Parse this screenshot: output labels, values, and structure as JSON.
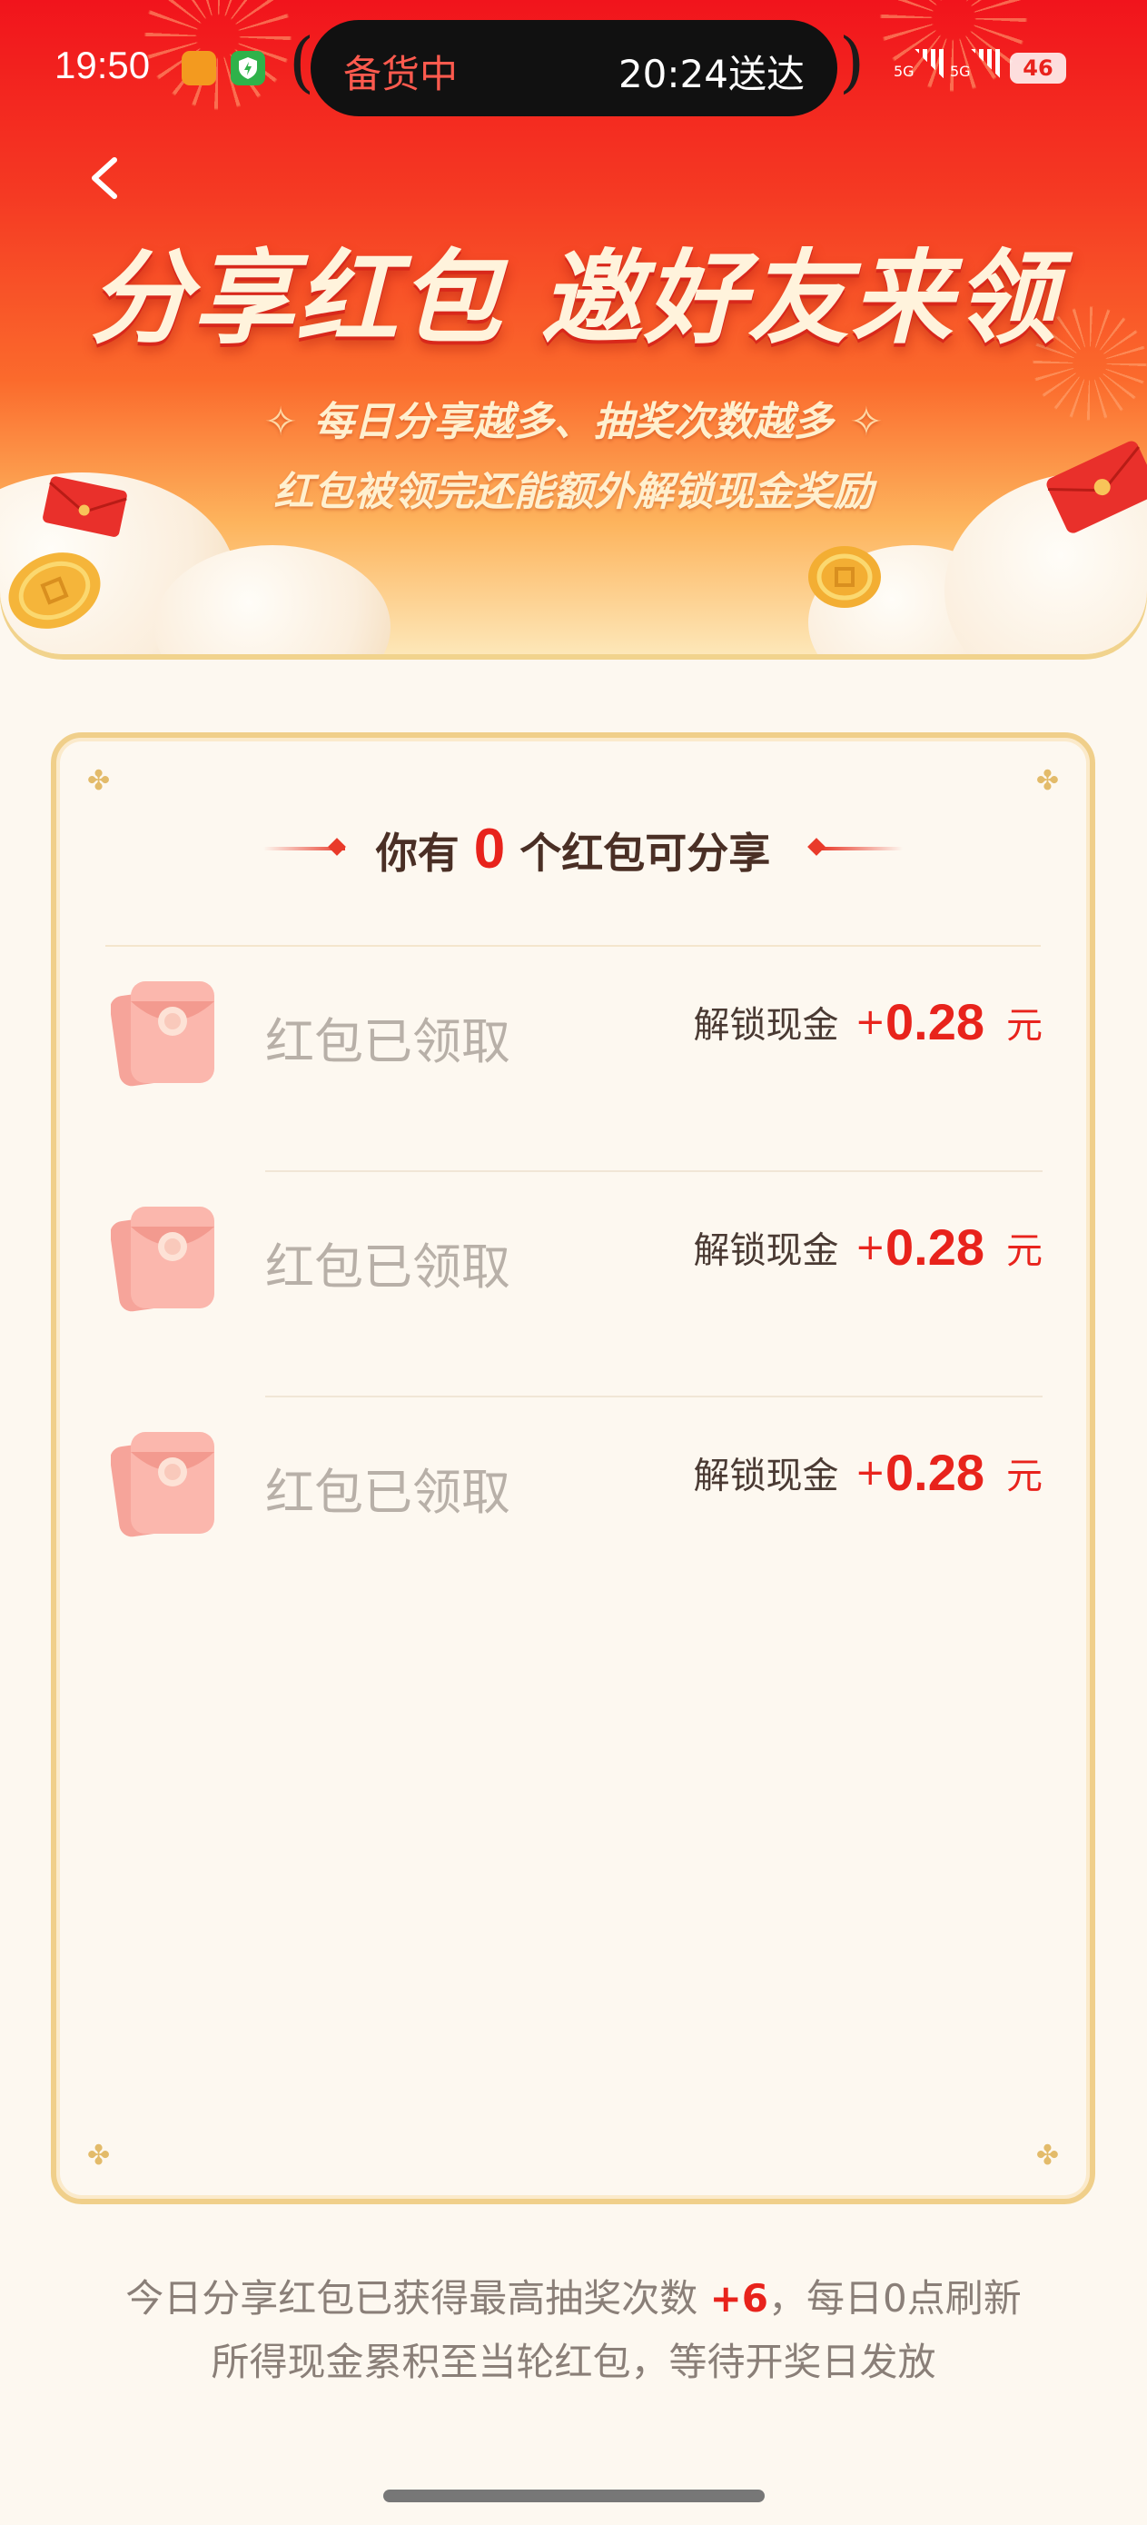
{
  "status_bar": {
    "time": "19:50",
    "island_left": "备货中",
    "island_right": "20:24送达",
    "signal_1": "5G",
    "signal_2": "5G",
    "battery": "46"
  },
  "hero": {
    "title": "分享红包 邀好友来领",
    "subtitle_1": "每日分享越多、抽奖次数越多",
    "subtitle_2": "红包被领完还能额外解锁现金奖励"
  },
  "card": {
    "header_prefix": "你有",
    "header_count": "0",
    "header_suffix": "个红包可分享",
    "rows": [
      {
        "title": "红包已领取",
        "reward_label": "解锁现金",
        "plus": "+",
        "amount": "0.28",
        "unit": "元"
      },
      {
        "title": "红包已领取",
        "reward_label": "解锁现金",
        "plus": "+",
        "amount": "0.28",
        "unit": "元"
      },
      {
        "title": "红包已领取",
        "reward_label": "解锁现金",
        "plus": "+",
        "amount": "0.28",
        "unit": "元"
      }
    ]
  },
  "footer": {
    "line1_prefix": "今日分享红包已获得最高抽奖次数",
    "line1_highlight": "+6",
    "line1_suffix": "，每日0点刷新",
    "line2": "所得现金累积至当轮红包，等待开奖日发放"
  },
  "colors": {
    "brand_red": "#e8231c",
    "card_border": "#f0cf8a",
    "page_bg": "#fdf8f0"
  }
}
